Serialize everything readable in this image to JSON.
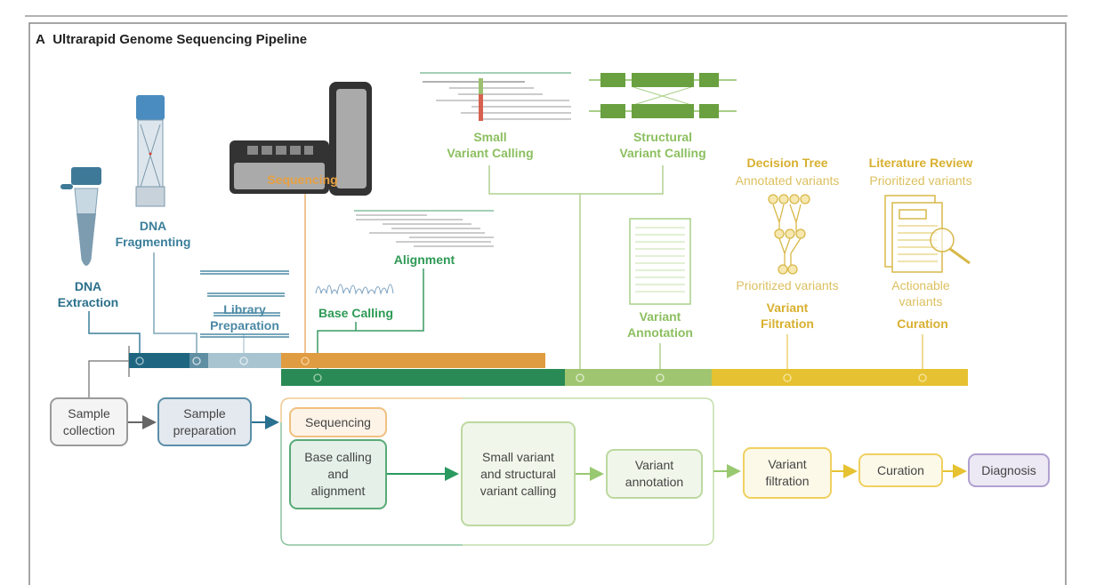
{
  "panel": {
    "letter": "A",
    "title": "Ultrarapid Genome Sequencing Pipeline"
  },
  "colors": {
    "dark_teal": "#1e6680",
    "mid_teal": "#5f8fa3",
    "light_teal": "#a9c4d1",
    "orange": "#e09c40",
    "green": "#2a8a55",
    "light_green": "#a0c570",
    "yellow": "#e6c232",
    "purple": "#b0a0d0"
  },
  "stages": {
    "dna_extraction": "DNA\nExtraction",
    "dna_fragmenting": "DNA\nFragmenting",
    "library_preparation": "Library\nPreparation",
    "sequencing": "Sequencing",
    "base_calling": "Base Calling",
    "alignment": "Alignment",
    "small_variant_calling": "Small\nVariant Calling",
    "structural_variant_calling": "Structural\nVariant Calling",
    "variant_annotation": "Variant\nAnnotation",
    "decision_tree": "Decision Tree",
    "decision_tree_input": "Annotated variants",
    "decision_tree_output": "Prioritized variants",
    "variant_filtration": "Variant\nFiltration",
    "literature_review": "Literature Review",
    "literature_input": "Prioritized variants",
    "literature_output": "Actionable\nvariants",
    "curation": "Curation"
  },
  "flow": {
    "sample_collection": "Sample\ncollection",
    "sample_preparation": "Sample\npreparation",
    "sequencing": "Sequencing",
    "base_calling_alignment": "Base calling\nand\nalignment",
    "variant_calling": "Small variant\nand structural\nvariant calling",
    "variant_annotation": "Variant\nannotation",
    "variant_filtration": "Variant\nfiltration",
    "curation": "Curation",
    "diagnosis": "Diagnosis"
  },
  "icons": [
    "sample-tube-icon",
    "fragmenting-tube-icon",
    "sequencer-icon",
    "dna-strands-icon",
    "chromatogram-icon",
    "alignment-reads-icon",
    "structural-variant-icon",
    "annotation-document-icon",
    "decision-tree-icon",
    "literature-magnifier-icon"
  ]
}
